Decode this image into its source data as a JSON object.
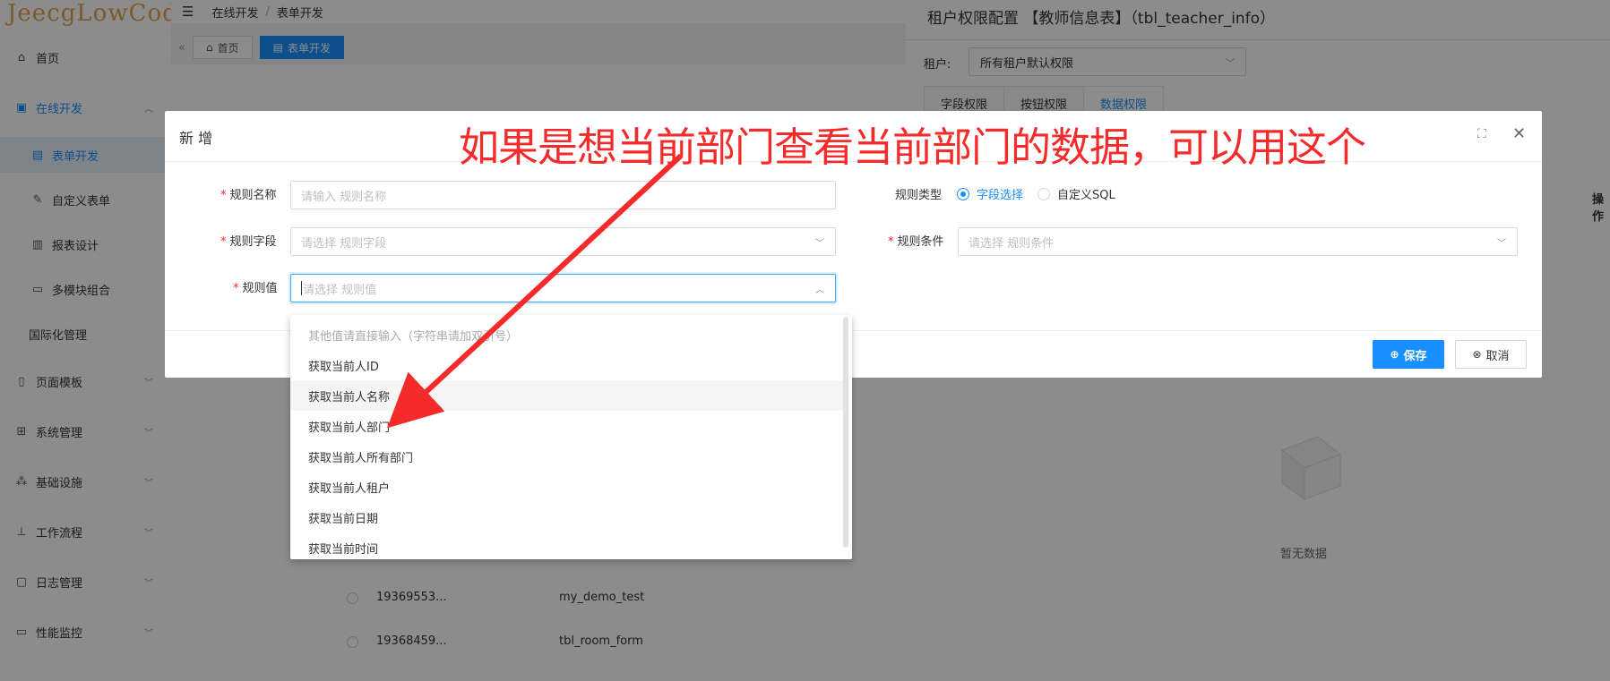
{
  "sidebar": {
    "logo": "JeecgLowCode",
    "items": [
      {
        "label": "首页",
        "icon": "home-icon"
      },
      {
        "label": "在线开发",
        "icon": "code-icon"
      },
      {
        "label": "表单开发",
        "icon": "form-icon"
      },
      {
        "label": "自定义表单",
        "icon": "edit-icon"
      },
      {
        "label": "报表设计",
        "icon": "report-icon"
      },
      {
        "label": "多模块组合",
        "icon": "module-icon"
      },
      {
        "label": "国际化管理",
        "icon": ""
      },
      {
        "label": "页面模板",
        "icon": "page-icon"
      },
      {
        "label": "系统管理",
        "icon": "grid-icon"
      },
      {
        "label": "基础设施",
        "icon": "cluster-icon"
      },
      {
        "label": "工作流程",
        "icon": "flow-icon"
      },
      {
        "label": "日志管理",
        "icon": "log-icon"
      },
      {
        "label": "性能监控",
        "icon": "monitor-icon"
      }
    ]
  },
  "header": {
    "breadcrumb": [
      "在线开发",
      "表单开发"
    ],
    "tabs": [
      {
        "label": "首页"
      },
      {
        "label": "表单开发"
      }
    ]
  },
  "background_table": {
    "rows": [
      {
        "id": "19369553...",
        "name": "my_demo_test"
      },
      {
        "id": "19368459...",
        "name": "tbl_room_form"
      }
    ]
  },
  "drawer": {
    "title": "租户权限配置 【教师信息表】（tbl_teacher_info）",
    "tenant_label": "租户:",
    "tenant_value": "所有租户默认权限",
    "tabs": [
      "字段权限",
      "按钮权限",
      "数据权限"
    ],
    "column_op": "操作",
    "empty_text": "暂无数据"
  },
  "modal": {
    "title": "新 增",
    "fields": {
      "rule_name": {
        "label": "规则名称",
        "placeholder": "请输入 规则名称"
      },
      "rule_field": {
        "label": "规则字段",
        "placeholder": "请选择 规则字段"
      },
      "rule_value": {
        "label": "规则值",
        "placeholder": "请选择 规则值"
      },
      "rule_type": {
        "label": "规则类型",
        "options": [
          "字段选择",
          "自定义SQL"
        ],
        "selected": "字段选择"
      },
      "rule_condition": {
        "label": "规则条件",
        "placeholder": "请选择 规则条件"
      }
    },
    "save_label": "保存",
    "cancel_label": "取消"
  },
  "dropdown": {
    "items": [
      "其他值请直接输入（字符串请加双引号）",
      "获取当前人ID",
      "获取当前人名称",
      "获取当前人部门",
      "获取当前人所有部门",
      "获取当前人租户",
      "获取当前日期",
      "获取当前时间"
    ]
  },
  "annotation": {
    "text": "如果是想当前部门查看当前部门的数据，可以用这个",
    "color": "#f52a2a"
  },
  "colors": {
    "primary": "#1890ff",
    "required": "#f5222d"
  }
}
